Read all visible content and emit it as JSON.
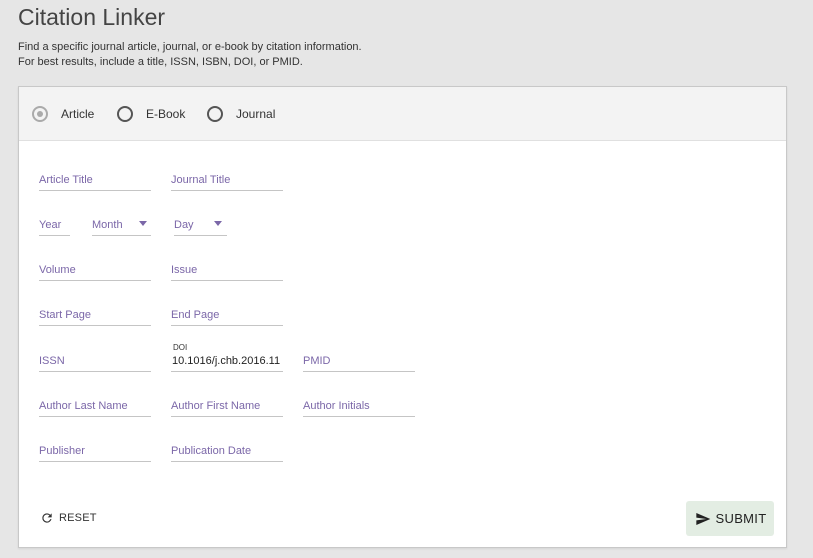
{
  "page": {
    "title": "Citation Linker",
    "desc_line1": "Find a specific journal article, journal, or e-book by citation information.",
    "desc_line2": "For best results, include a title, ISSN, ISBN, DOI, or PMID."
  },
  "citation_types": [
    {
      "label": "Article",
      "selected": true
    },
    {
      "label": "E-Book",
      "selected": false
    },
    {
      "label": "Journal",
      "selected": false
    }
  ],
  "fields": {
    "article_title": {
      "placeholder": "Article Title"
    },
    "journal_title": {
      "placeholder": "Journal Title"
    },
    "year": {
      "placeholder": "Year"
    },
    "month": {
      "placeholder": "Month"
    },
    "day": {
      "placeholder": "Day"
    },
    "volume": {
      "placeholder": "Volume"
    },
    "issue": {
      "placeholder": "Issue"
    },
    "start_page": {
      "placeholder": "Start Page"
    },
    "end_page": {
      "placeholder": "End Page"
    },
    "issn": {
      "placeholder": "ISSN"
    },
    "doi": {
      "label": "DOI",
      "value": "10.1016/j.chb.2016.11"
    },
    "pmid": {
      "placeholder": "PMID"
    },
    "author_last": {
      "placeholder": "Author Last Name"
    },
    "author_first": {
      "placeholder": "Author First Name"
    },
    "author_initials": {
      "placeholder": "Author Initials"
    },
    "publisher": {
      "placeholder": "Publisher"
    },
    "publication_date": {
      "placeholder": "Publication Date"
    }
  },
  "actions": {
    "reset_label": "RESET",
    "submit_label": "SUBMIT"
  },
  "colors": {
    "placeholder": "#7b67a8",
    "submit_bg": "#e3ede3",
    "page_bg": "#e6e6e6"
  },
  "icons": {
    "reset": "refresh-icon",
    "submit": "send-icon"
  }
}
